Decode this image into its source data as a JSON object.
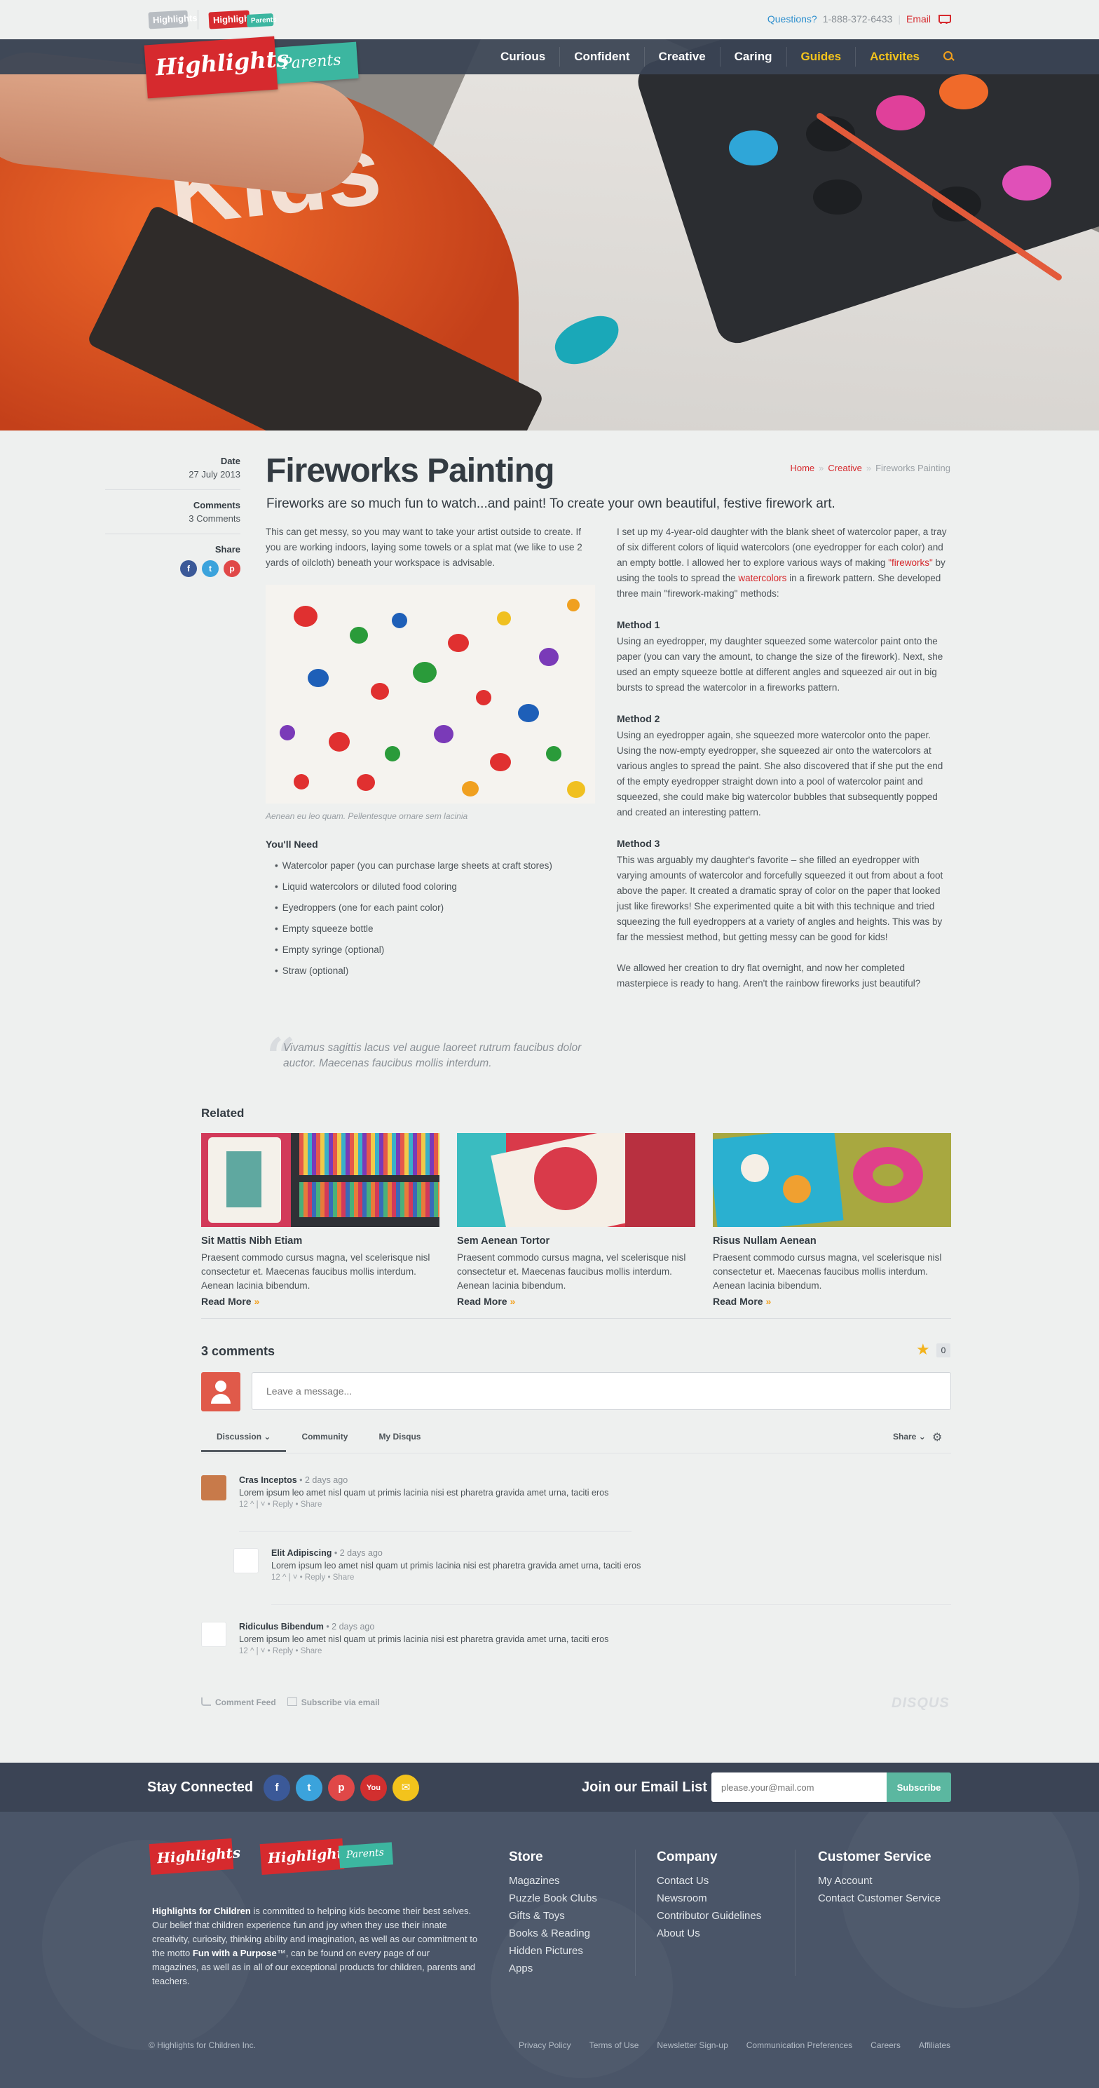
{
  "topbar": {
    "brand_logo_1": "Highlights",
    "brand_logo_2": "Highlights",
    "brand_logo_2_sub": "Parents",
    "questions": "Questions?",
    "phone": "1-888-372-6433",
    "separator": "|",
    "email": "Email"
  },
  "nav": {
    "logo_main": "Highlights",
    "logo_sub": "Parents",
    "items": [
      "Curious",
      "Confident",
      "Creative",
      "Caring",
      "Guides",
      "Activites"
    ]
  },
  "article": {
    "title": "Fireworks Painting",
    "subtitle": "Fireworks are so much fun to watch...and paint! To create your own beautiful, festive firework art.",
    "breadcrumb": [
      "Home",
      "Creative",
      "Fireworks Painting"
    ],
    "breadcrumb_sep": "»",
    "meta": {
      "date_label": "Date",
      "date_value": "27 July 2013",
      "comments_label": "Comments",
      "comments_value": "3 Comments",
      "share_label": "Share"
    },
    "intro": "This can get messy, so you may want to take your artist outside to create. If you are working indoors, laying some towels or a splat mat (we like to use 2 yards of oilcloth) beneath your workspace is advisable.",
    "image_caption": "Aenean eu leo quam. Pellentesque ornare sem lacinia",
    "need_title": "You'll Need",
    "need_items": [
      "Watercolor paper (you can purchase large sheets at craft stores)",
      "Liquid watercolors or diluted food coloring",
      "Eyedroppers (one for each paint color)",
      "Empty squeeze bottle",
      "Empty syringe (optional)",
      "Straw (optional)"
    ],
    "right_intro_1": "I set up my 4-year-old daughter with the blank sheet of watercolor paper, a tray of six different colors of liquid watercolors (one eyedropper for each color) and an empty bottle.  I allowed her to explore various ways of making ",
    "right_link_1": "\"fireworks\"",
    "right_intro_2": " by using the tools to spread the ",
    "right_link_2": "watercolors",
    "right_intro_3": " in a firework pattern.  She developed three main \"firework-making\" methods:",
    "method1_title": "Method 1",
    "method1_text": "Using an eyedropper, my daughter squeezed some watercolor paint onto the paper (you can vary the amount, to change the size of the firework). Next, she used an empty squeeze bottle at different angles and squeezed air out in big bursts to spread the watercolor in a fireworks pattern.",
    "method2_title": "Method 2",
    "method2_text": "Using an eyedropper again, she squeezed more watercolor onto the paper. Using the now-empty eyedropper, she squeezed air onto the watercolors at various angles to spread the paint.  She also discovered that if she put the end of the empty eyedropper straight down into a pool of watercolor paint and squeezed, she could make big watercolor bubbles that subsequently popped and created an interesting pattern.",
    "method3_title": "Method 3",
    "method3_text": "This was arguably my daughter's favorite – she filled an eyedropper with varying amounts of watercolor and forcefully squeezed it out from about a foot above the paper.  It created a dramatic spray of color on the paper that looked just like fireworks!  She experimented quite a bit with this technique and tried squeezing the full eyedroppers at a variety of angles and heights. This was by far the messiest method, but getting messy can be good for kids!",
    "closing": "We allowed her creation to dry flat overnight, and now her completed masterpiece is ready to hang. Aren't the rainbow fireworks just beautiful?",
    "quote": "Vivamus sagittis lacus vel augue laoreet rutrum faucibus dolor auctor. Maecenas faucibus mollis interdum."
  },
  "related": {
    "title": "Related",
    "items": [
      {
        "name": "Sit Mattis Nibh Etiam",
        "desc": "Praesent commodo cursus magna, vel scelerisque nisl consectetur et. Maecenas faucibus mollis interdum. Aenean lacinia bibendum.",
        "more": "Read More",
        "arrow": "»"
      },
      {
        "name": "Sem Aenean Tortor",
        "desc": "Praesent commodo cursus magna, vel scelerisque nisl consectetur et. Maecenas faucibus mollis interdum. Aenean lacinia bibendum.",
        "more": "Read More",
        "arrow": "»"
      },
      {
        "name": "Risus Nullam Aenean",
        "desc": "Praesent commodo cursus magna, vel scelerisque nisl consectetur et. Maecenas faucibus mollis interdum. Aenean lacinia bibendum.",
        "more": "Read More",
        "arrow": "»"
      }
    ]
  },
  "comments": {
    "title": "3 comments",
    "star_count": "0",
    "input_placeholder": "Leave a message...",
    "tabs": [
      "Discussion",
      "Community",
      "My Disqus"
    ],
    "share_menu": "Share",
    "list": [
      {
        "name": "Cras Inceptos",
        "time": "• 2 days ago",
        "text": "Lorem ipsum leo amet nisl quam ut primis lacinia nisi est pharetra gravida amet urna, taciti eros",
        "actions": "12 ^  |  ˅ • Reply  •  Share"
      },
      {
        "name": "Elit Adipiscing",
        "time": "• 2 days ago",
        "text": "Lorem ipsum leo amet nisl quam ut primis lacinia nisi est pharetra gravida amet urna, taciti eros",
        "actions": "12 ^  |  ˅  •  Reply  •  Share"
      },
      {
        "name": "Ridiculus Bibendum",
        "time": "• 2 days ago",
        "text": "Lorem ipsum leo amet nisl quam ut primis lacinia nisi est pharetra gravida amet urna, taciti eros",
        "actions": "12 ^  |  ˅ • Reply  •  Share"
      }
    ],
    "feed": "Comment Feed",
    "subscribe": "Subscribe via email",
    "disqus": "DISQUS"
  },
  "connect": {
    "title": "Stay Connected",
    "join_title": "Join our Email List",
    "email_placeholder": "please.your@mail.com",
    "subscribe": "Subscribe"
  },
  "footer": {
    "logo_1": "Highlights",
    "logo_2": "Highlights",
    "logo_2_sub": "Parents",
    "about_strong": "Highlights for Children",
    "about_1": " is committed to helping kids become their best selves. Our belief that children experience fun and joy when they use their innate creativity, curiosity, thinking ability and imagination, as well as our commitment to the motto ",
    "about_strong_2": "Fun with a Purpose",
    "about_2": "™, can be found on every page of our magazines, as well as in all of our exceptional products for children, parents and teachers.",
    "store_title": "Store",
    "store_items": [
      "Magazines",
      "Puzzle Book Clubs",
      "Gifts & Toys",
      "Books & Reading",
      "Hidden Pictures",
      "Apps"
    ],
    "company_title": "Company",
    "company_items": [
      "Contact Us",
      "Newsroom",
      "Contributor Guidelines",
      "About Us"
    ],
    "cs_title": "Customer Service",
    "cs_items": [
      "My Account",
      "Contact Customer Service"
    ],
    "copyright": "© Highlights for Children Inc.",
    "links": [
      "Privacy Policy",
      "Terms of Use",
      "Newsletter Sign-up",
      "Communication Preferences",
      "Careers",
      "Affiliates"
    ]
  },
  "colors": {
    "brand_red": "#d62a2e",
    "brand_teal": "#3cb6a0",
    "nav_yellow": "#f3c31c",
    "nav_bg": "#3a4454",
    "footer_bg": "#4a5568",
    "subscribe_green": "#5bb7a0"
  }
}
